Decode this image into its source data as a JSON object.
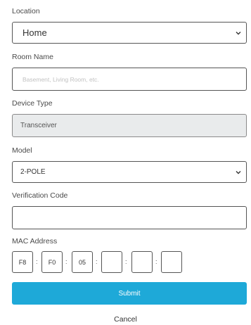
{
  "location": {
    "label": "Location",
    "selected": "Home"
  },
  "room_name": {
    "label": "Room Name",
    "placeholder": "Basement, Living Room, etc."
  },
  "device_type": {
    "label": "Device Type",
    "value": "Transceiver"
  },
  "model": {
    "label": "Model",
    "selected": "2-POLE"
  },
  "verification_code": {
    "label": "Verification Code",
    "value": ""
  },
  "mac_address": {
    "label": "MAC Address",
    "separator": ":",
    "octets": [
      "F8",
      "F0",
      "05",
      "",
      "",
      ""
    ]
  },
  "actions": {
    "submit": "Submit",
    "cancel": "Cancel"
  },
  "icons": {
    "select_arrow": "chevron-down-icon"
  },
  "colors": {
    "submit_button": "#1ea9d8",
    "disabled_field": "#e9ebec"
  }
}
